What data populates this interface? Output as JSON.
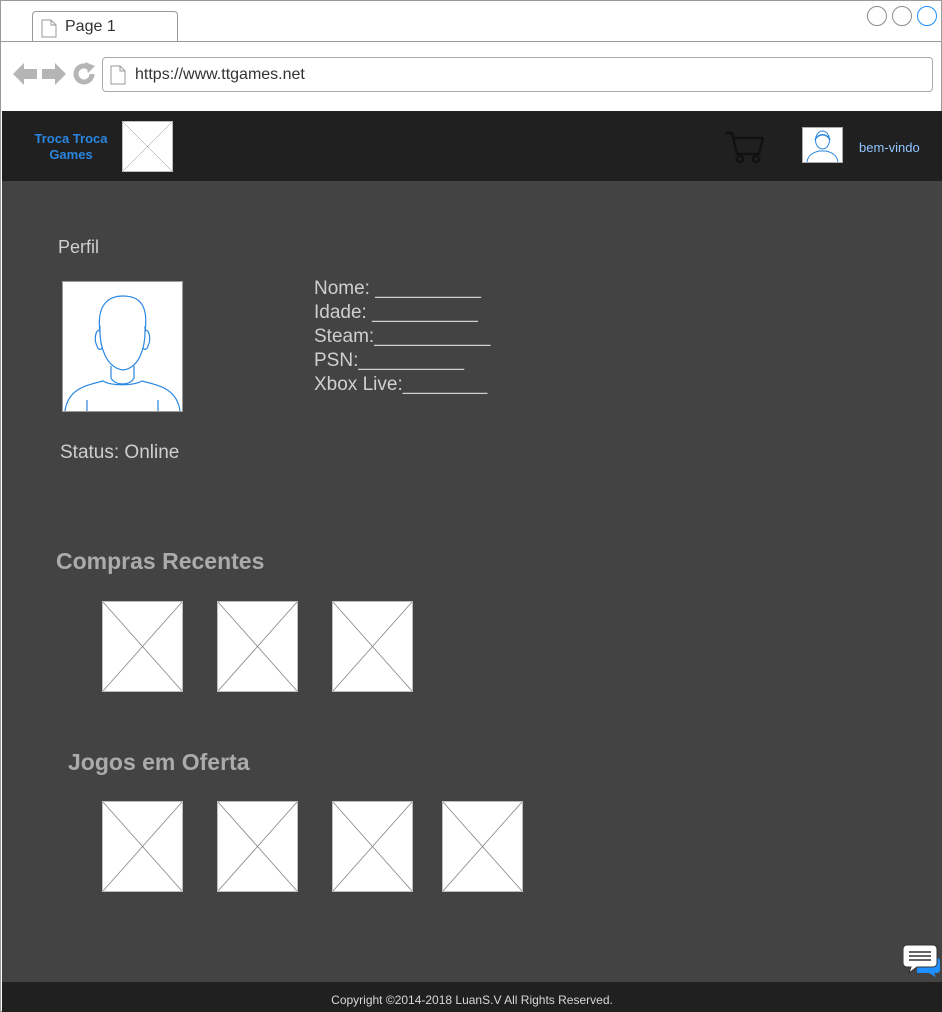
{
  "browser": {
    "tab_label": "Page 1",
    "url": "https://www.ttgames.net",
    "icons": [
      "page-icon",
      "back-arrow-icon",
      "forward-arrow-icon",
      "reload-icon"
    ]
  },
  "header": {
    "brand": "Troca Troca Games",
    "welcome": "bem-vindo",
    "icons": [
      "cart-icon",
      "user-avatar-icon"
    ],
    "accent_color": "#2a86e0"
  },
  "profile": {
    "title": "Perfil",
    "status": "Status: Online",
    "fields": [
      "Nome: __________",
      "Idade: __________",
      "Steam:___________",
      "PSN:__________",
      "Xbox Live:________"
    ]
  },
  "recent": {
    "title": "Compras Recentes",
    "count": 3
  },
  "offers": {
    "title": "Jogos em Oferta",
    "count": 4
  },
  "footer": {
    "copyright": "Copyright ©2014-2018 LuanS.V All Rights Reserved."
  },
  "colors": {
    "header_bg": "#202020",
    "main_bg": "#434343"
  }
}
